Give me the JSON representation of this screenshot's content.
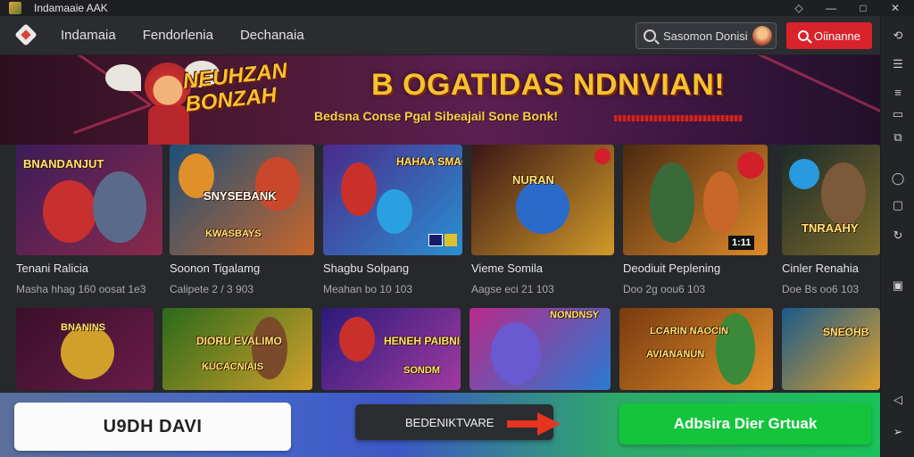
{
  "window": {
    "title": "Indamaaie AAK",
    "controls": [
      "◇",
      "—",
      "□",
      "✕"
    ]
  },
  "nav": {
    "links": [
      "Indamaia",
      "Fendorlenia",
      "Dechanaia"
    ],
    "search_text": "Sasomon Donisi",
    "signin_label": "Oiinanne"
  },
  "banner": {
    "logo_text": "NEUHZAN BONZAH",
    "title": "B OGATIDAS NDNVIAN!",
    "subtitle": "Bedsna Conse Pgal Sibeajail Sone Bonk!"
  },
  "row1": [
    {
      "name": "Tenani Ralicia",
      "meta": "Masha hhag 160 oosat 1e3",
      "thumb_label": "BNANDANJUT",
      "bg": [
        "#3b1c5a",
        "#8a2a4a"
      ]
    },
    {
      "name": "Soonon Tigalamg",
      "meta": "Calipete 2 / 3 903",
      "thumb_label": "SNYSEBANK",
      "thumb_label2": "KWASBAYS",
      "bg": [
        "#1d4f7a",
        "#c9672a"
      ]
    },
    {
      "name": "Shagbu Solpang",
      "meta": "Meahan bo 10 103",
      "thumb_label": "HAHAA SMAGON",
      "bg": [
        "#4a2a8a",
        "#2a8fd1"
      ]
    },
    {
      "name": "Vieme Somila",
      "meta": "Aagse eci 21 103",
      "thumb_label": "NURAN",
      "bg": [
        "#3a1616",
        "#d19a2a"
      ]
    },
    {
      "name": "Deodiuit Peplening",
      "meta": "Doo 2g oou6 103",
      "badge": "1:11",
      "bg": [
        "#4a2a10",
        "#e08a2a"
      ]
    },
    {
      "name": "Cinler Renahia",
      "meta": "Doe Bs oo6 103",
      "thumb_label": "TNRAAHY",
      "bg": [
        "#1c2a2a",
        "#7a6a2a"
      ]
    }
  ],
  "row2": [
    {
      "thumb_label": "BNANINS",
      "bg": [
        "#3a0f2a",
        "#6a1c4a"
      ]
    },
    {
      "thumb_label": "DIORU EVALIMO",
      "thumb_label2": "KUCACNIAIS",
      "bg": [
        "#2a6a1a",
        "#d1a02a"
      ]
    },
    {
      "thumb_label": "HENEH PAIBNIG",
      "thumb_label2": "SONDM",
      "bg": [
        "#2a1a7a",
        "#a13aa1"
      ]
    },
    {
      "thumb_label": "NONDNSY",
      "bg": [
        "#b82a8a",
        "#2a7ad1"
      ]
    },
    {
      "thumb_label": "LCARIN NAOCIN",
      "thumb_label2": "AVIANANUN",
      "bg": [
        "#7a3a10",
        "#e0902a"
      ]
    },
    {
      "thumb_label": "SNEOHB",
      "bg": [
        "#1a5a8a",
        "#e0a02a"
      ]
    }
  ],
  "actions": {
    "primary_white": "U9DH DAVI",
    "secondary_dark": "BEDENIKTVARE",
    "cta_green": "Adbsira Dier Grtuak"
  },
  "colors": {
    "accent_red": "#d9232a",
    "accent_green": "#14c53c",
    "title_gold": "#f6c230"
  }
}
